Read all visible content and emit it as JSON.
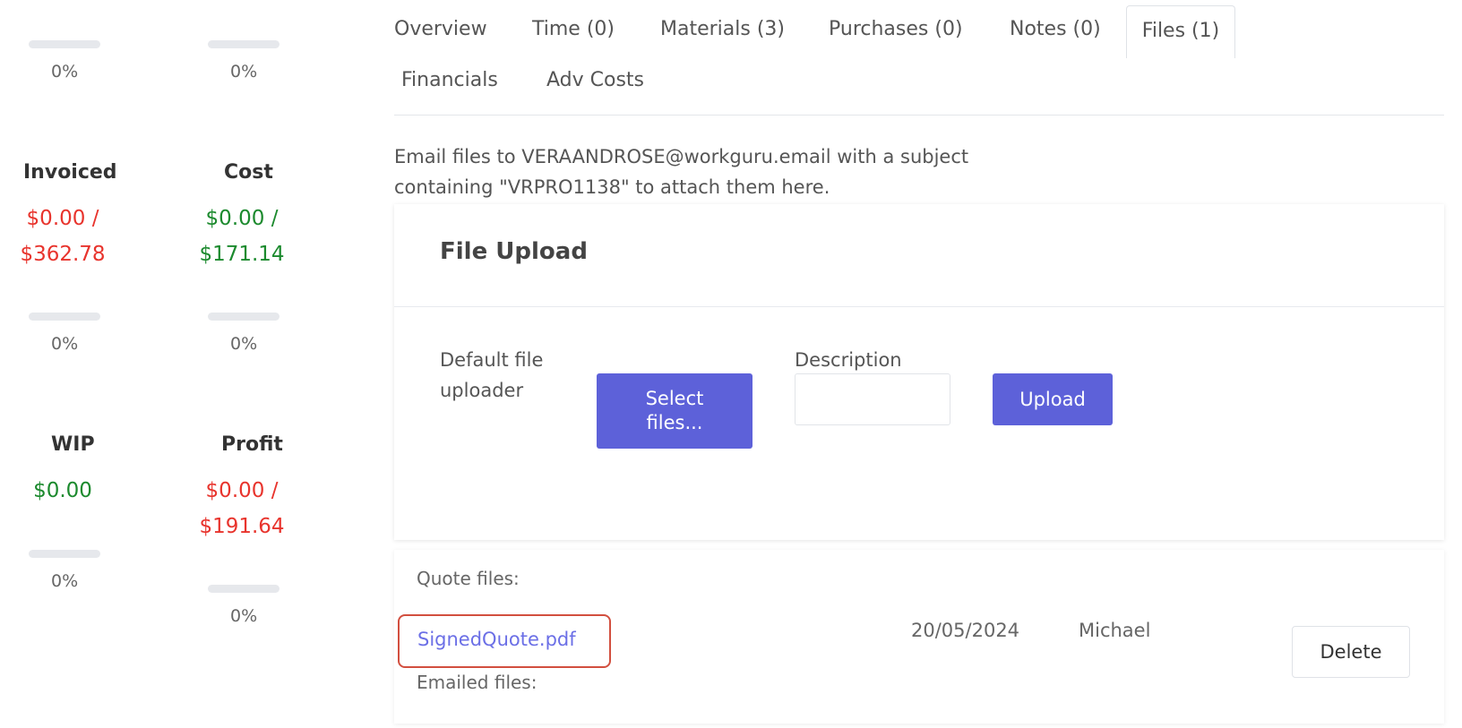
{
  "stats": {
    "row1": {
      "left_pct_text": "0%",
      "left_pct": 0,
      "right_pct_text": "0%",
      "right_pct": 0
    },
    "invoiced": {
      "title": "Invoiced",
      "line1": "$0.00 /",
      "line2": "$362.78",
      "pct_text": "0%",
      "pct": 0
    },
    "cost": {
      "title": "Cost",
      "line1": "$0.00 /",
      "line2": "$171.14",
      "pct_text": "0%",
      "pct": 0
    },
    "wip": {
      "title": "WIP",
      "line1": "$0.00",
      "pct_text": "0%",
      "pct": 0
    },
    "profit": {
      "title": "Profit",
      "line1": "$0.00 /",
      "line2": "$191.64",
      "pct_text": "0%",
      "pct": 0
    },
    "colors": {
      "negative": "#e8342d",
      "positive": "#1c8a2e",
      "bar_track": "#e6e8ec"
    }
  },
  "tabs": [
    {
      "label": "Overview",
      "active": false
    },
    {
      "label": "Time (0)",
      "active": false
    },
    {
      "label": "Materials (3)",
      "active": false
    },
    {
      "label": "Purchases (0)",
      "active": false
    },
    {
      "label": "Notes (0)",
      "active": false
    },
    {
      "label": "Files (1)",
      "active": true
    },
    {
      "label": "Financials",
      "active": false
    },
    {
      "label": "Adv Costs",
      "active": false
    }
  ],
  "email_info": {
    "line1": "Email files to VERAANDROSE@workguru.email with a subject",
    "line2": "containing \"VRPRO1138\" to attach them here."
  },
  "upload": {
    "title": "File Upload",
    "uploader_label_line1": "Default file",
    "uploader_label_line2": "uploader",
    "select_line1": "Select",
    "select_line2": "files...",
    "description_label": "Description",
    "description_value": "",
    "upload_button": "Upload",
    "accent": "#5d61d9"
  },
  "files": {
    "quote_label": "Quote files:",
    "emailed_label": "Emailed files:",
    "items": [
      {
        "name": "SignedQuote.pdf",
        "date": "20/05/2024",
        "user": "Michael",
        "delete_label": "Delete"
      }
    ]
  }
}
